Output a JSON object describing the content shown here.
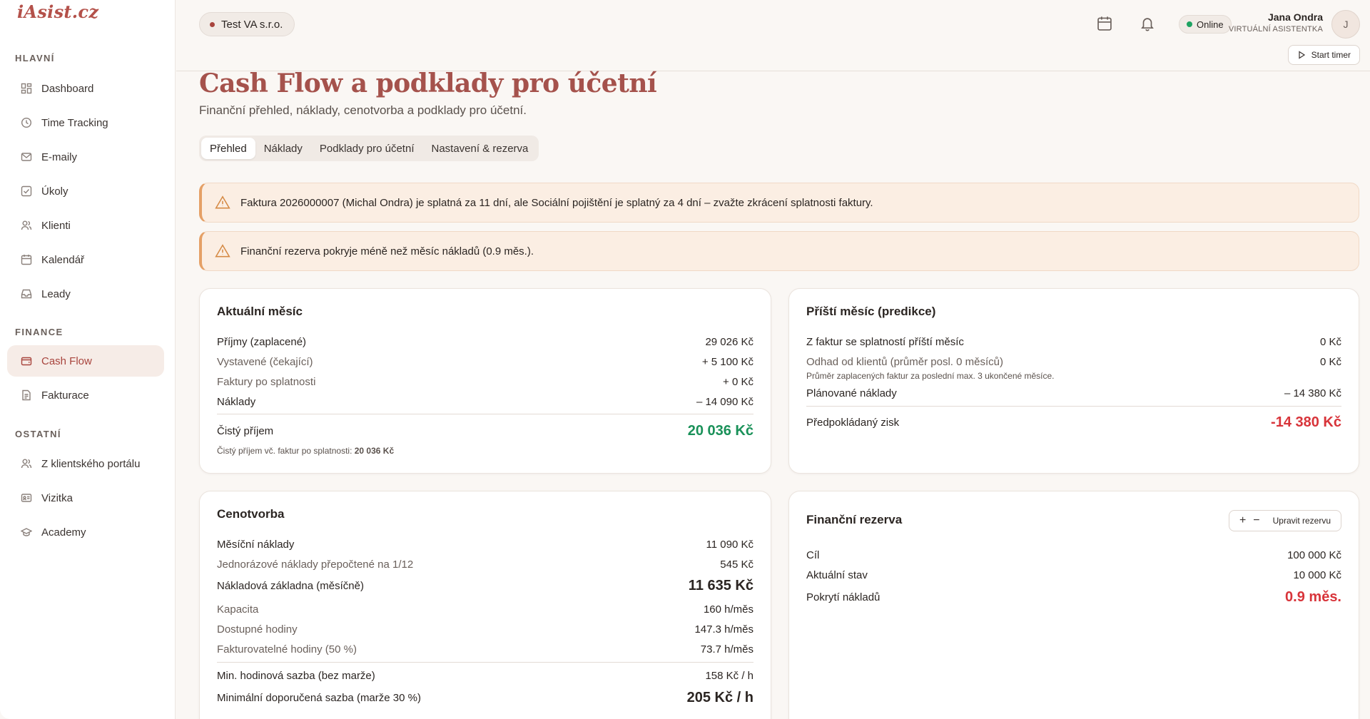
{
  "brand": {
    "logo": "iAsist.cz"
  },
  "sidebar": {
    "sections": [
      {
        "label": "HLAVNÍ"
      },
      {
        "label": "FINANCE"
      },
      {
        "label": "OSTATNÍ"
      }
    ],
    "items": [
      {
        "label": "Dashboard",
        "icon": "dashboard-icon"
      },
      {
        "label": "Time Tracking",
        "icon": "clock-icon"
      },
      {
        "label": "E-maily",
        "icon": "mail-icon"
      },
      {
        "label": "Úkoly",
        "icon": "checkbox-icon"
      },
      {
        "label": "Klienti",
        "icon": "users-icon"
      },
      {
        "label": "Kalendář",
        "icon": "calendar-icon"
      },
      {
        "label": "Leady",
        "icon": "inbox-icon"
      },
      {
        "label": "Cash Flow",
        "icon": "wallet-icon",
        "active": true
      },
      {
        "label": "Fakturace",
        "icon": "document-icon"
      },
      {
        "label": "Z klientského portálu",
        "icon": "users-icon"
      },
      {
        "label": "Vizitka",
        "icon": "id-card-icon"
      },
      {
        "label": "Academy",
        "icon": "graduation-cap-icon"
      }
    ]
  },
  "topbar": {
    "company": "Test VA s.r.o.",
    "status": "Online",
    "user_name": "Jana Ondra",
    "user_role": "VIRTUÁLNÍ ASISTENTKA",
    "avatar_initial": "J",
    "timer_label": "Start timer"
  },
  "page": {
    "title": "Cash Flow a podklady pro účetní",
    "subtitle": "Finanční přehled, náklady, cenotvorba a podklady pro účetní."
  },
  "tabs": [
    {
      "label": "Přehled",
      "active": true
    },
    {
      "label": "Náklady"
    },
    {
      "label": "Podklady pro účetní"
    },
    {
      "label": "Nastavení & rezerva"
    }
  ],
  "alerts": [
    "Faktura 2026000007 (Michal Ondra) je splatná za 11 dní, ale Sociální pojištění je splatný za 4 dní – zvažte zkrácení splatnosti faktury.",
    "Finanční rezerva pokryje méně než měsíc nákladů (0.9 měs.)."
  ],
  "current_month": {
    "title": "Aktuální měsíc",
    "rows": [
      {
        "label": "Příjmy (zaplacené)",
        "value": "29 026 Kč"
      },
      {
        "label": "Vystavené (čekající)",
        "value": "+ 5 100 Kč"
      },
      {
        "label": "Faktury po splatnosti",
        "value": "+ 0 Kč"
      },
      {
        "label": "Náklady",
        "value": "– 14 090 Kč"
      }
    ],
    "net_label": "Čistý příjem",
    "net_value": "20 036 Kč",
    "note_label": "Čistý příjem vč. faktur po splatnosti:",
    "note_value": "20 036 Kč"
  },
  "next_month": {
    "title": "Příští měsíc (predikce)",
    "rows": [
      {
        "label": "Z faktur se splatností příští měsíc",
        "value": "0 Kč"
      },
      {
        "label": "Odhad od klientů (průměr posl. 0 měsíců)",
        "value": "0 Kč"
      }
    ],
    "estimate_note": "Průměr zaplacených faktur za poslední max. 3 ukončené měsíce.",
    "planned_label": "Plánované náklady",
    "planned_value": "– 14 380 Kč",
    "profit_label": "Předpokládaný zisk",
    "profit_value": "-14 380 Kč"
  },
  "pricing": {
    "title": "Cenotvorba",
    "rows": [
      {
        "label": "Měsíční náklady",
        "value": "11 090 Kč"
      },
      {
        "label": "Jednorázové náklady přepočtené na 1/12",
        "value": "545 Kč"
      }
    ],
    "base_label": "Nákladová základna (měsíčně)",
    "base_value": "11 635 Kč",
    "capacity_rows": [
      {
        "label": "Kapacita",
        "value": "160 h/měs"
      },
      {
        "label": "Dostupné hodiny",
        "value": "147.3 h/měs"
      },
      {
        "label": "Fakturovatelné hodiny (50 %)",
        "value": "73.7 h/měs"
      }
    ],
    "min_rate_label": "Min. hodinová sazba (bez marže)",
    "min_rate_value": "158 Kč / h",
    "rec_rate_label": "Minimální doporučená sazba (marže 30 %)",
    "rec_rate_value": "205 Kč / h"
  },
  "reserve": {
    "title": "Finanční rezerva",
    "button_label": "Upravit rezervu",
    "rows": [
      {
        "label": "Cíl",
        "value": "100 000 Kč"
      },
      {
        "label": "Aktuální stav",
        "value": "10 000 Kč"
      }
    ],
    "coverage_label": "Pokrytí nákladů",
    "coverage_value": "0.9 měs."
  },
  "colors": {
    "accent": "#a8443d",
    "positive": "#1a9159",
    "negative": "#d8343a",
    "warning": "#e5a066"
  }
}
